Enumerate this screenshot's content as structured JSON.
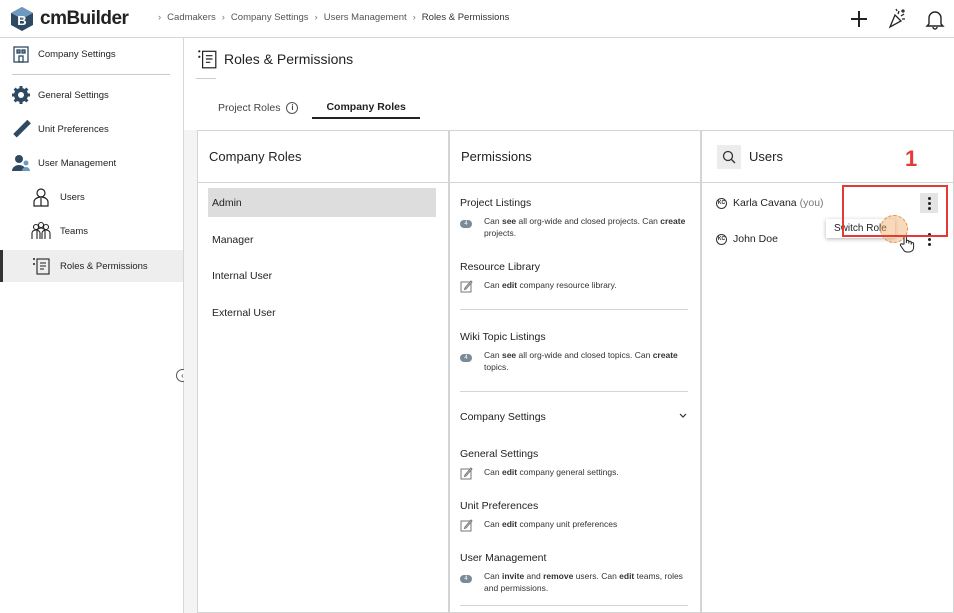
{
  "app": {
    "logo_text": "cmBuilder"
  },
  "breadcrumb": [
    "Cadmakers",
    "Company Settings",
    "Users Management",
    "Roles & Permissions"
  ],
  "top_icons": [
    "plus-icon",
    "celebrate-icon",
    "bell-icon"
  ],
  "sidebar": {
    "header": "Company Settings",
    "items": [
      {
        "label": "General Settings",
        "icon": "gear-icon"
      },
      {
        "label": "Unit Preferences",
        "icon": "ruler-icon"
      },
      {
        "label": "User Management",
        "icon": "user-group-icon"
      },
      {
        "label": "Users",
        "icon": "user-icon"
      },
      {
        "label": "Teams",
        "icon": "teams-icon"
      },
      {
        "label": "Roles & Permissions",
        "icon": "roles-icon",
        "active": true
      }
    ]
  },
  "page": {
    "title": "Roles & Permissions",
    "tabs": [
      {
        "label": "Project Roles",
        "active": false
      },
      {
        "label": "Company Roles",
        "active": true
      }
    ]
  },
  "roles_panel": {
    "title": "Company Roles",
    "roles": [
      "Admin",
      "Manager",
      "Internal User",
      "External User"
    ],
    "selected": "Admin"
  },
  "permissions_panel": {
    "title": "Permissions",
    "badge": "4",
    "project_listings": {
      "title": "Project Listings",
      "t1": "Can ",
      "b1": "see",
      "t2": " all org-wide and closed projects. Can ",
      "b2": "create",
      "t3": " projects."
    },
    "resource_library": {
      "title": "Resource Library",
      "t1": "Can ",
      "b1": "edit",
      "t2": " company resource library."
    },
    "wiki_topics": {
      "title": "Wiki Topic Listings",
      "t1": "Can ",
      "b1": "see",
      "t2": " all org-wide and closed topics. Can ",
      "b2": "create",
      "t3": " topics."
    },
    "company_settings": {
      "title": "Company Settings"
    },
    "general_settings": {
      "title": "General Settings",
      "t1": "Can ",
      "b1": "edit",
      "t2": " company general settings."
    },
    "unit_preferences": {
      "title": "Unit Preferences",
      "t1": "Can ",
      "b1": "edit",
      "t2": " company unit preferences"
    },
    "user_management": {
      "title": "User Management",
      "t1": "Can ",
      "b1": "invite",
      "t2": " and ",
      "b2": "remove",
      "t3": " users. Can ",
      "b3": "edit",
      "t4": " teams, roles and permissions."
    }
  },
  "users_panel": {
    "title": "Users",
    "users": [
      {
        "initials": "KC",
        "name": "Karla Cavana",
        "suffix": "(you)"
      },
      {
        "initials": "KC",
        "name": "John Doe",
        "suffix": ""
      }
    ],
    "menu_item": "Switch Role"
  },
  "annotation": {
    "step": "1",
    "color": "#e53935"
  }
}
